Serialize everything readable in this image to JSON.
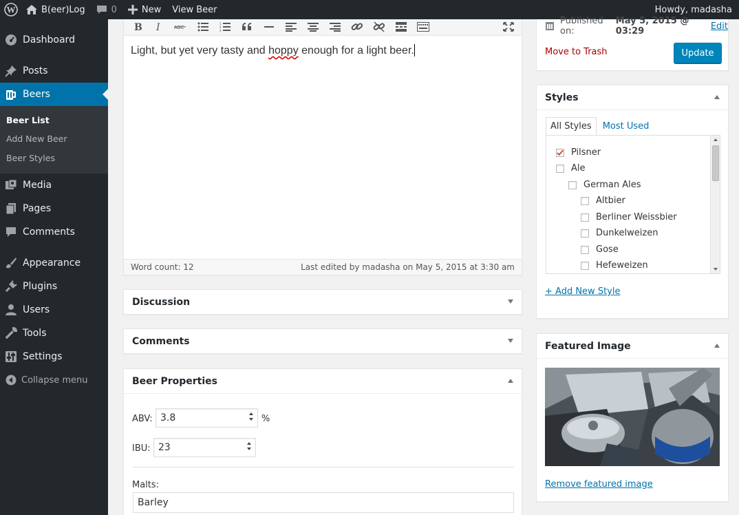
{
  "adminbar": {
    "site_name": "B(eer)Log",
    "comments_count": "0",
    "new_label": "New",
    "view_label": "View Beer",
    "greeting": "Howdy, madasha"
  },
  "sidebar": {
    "items": [
      {
        "label": "Dashboard",
        "icon": "dashboard-icon"
      },
      {
        "label": "Posts",
        "icon": "pushpin-icon"
      },
      {
        "label": "Beers",
        "icon": "beer-mug-icon"
      },
      {
        "label": "Media",
        "icon": "media-icon"
      },
      {
        "label": "Pages",
        "icon": "pages-icon"
      },
      {
        "label": "Comments",
        "icon": "comment-icon"
      },
      {
        "label": "Appearance",
        "icon": "paintbrush-icon"
      },
      {
        "label": "Plugins",
        "icon": "plug-icon"
      },
      {
        "label": "Users",
        "icon": "users-icon"
      },
      {
        "label": "Tools",
        "icon": "wrench-icon"
      },
      {
        "label": "Settings",
        "icon": "settings-icon"
      }
    ],
    "submenu": [
      "Beer List",
      "Add New Beer",
      "Beer Styles"
    ],
    "collapse_label": "Collapse menu",
    "active_color": "#0073aa"
  },
  "editor": {
    "content_before": "Light, but yet very tasty and ",
    "content_misspelled": "hoppy",
    "content_after": " enough for a light beer.",
    "word_count": "Word count: 12",
    "last_edited": "Last edited by madasha on May 5, 2015 at 3:30 am"
  },
  "boxes": {
    "discussion_title": "Discussion",
    "comments_title": "Comments",
    "beer_properties_title": "Beer Properties"
  },
  "beer_properties": {
    "abv_label": "ABV:",
    "abv_value": "3.8",
    "abv_unit": "%",
    "ibu_label": "IBU:",
    "ibu_value": "23",
    "malts_label": "Malts:",
    "malts_value": "Barley"
  },
  "publish": {
    "published_prefix": "Published on: ",
    "published_date": "May 5, 2015 @ 03:29",
    "edit_link": "Edit",
    "trash_label": "Move to Trash",
    "update_label": "Update"
  },
  "styles": {
    "title": "Styles",
    "tab_all": "All Styles",
    "tab_most_used": "Most Used",
    "terms": [
      {
        "label": "Pilsner",
        "checked": true
      },
      {
        "label": "Ale",
        "checked": false
      },
      {
        "label": "German Ales",
        "checked": false
      },
      {
        "label": "Altbier",
        "checked": false
      },
      {
        "label": "Berliner Weissbier",
        "checked": false
      },
      {
        "label": "Dunkelweizen",
        "checked": false
      },
      {
        "label": "Gose",
        "checked": false
      },
      {
        "label": "Hefeweizen",
        "checked": false
      }
    ],
    "add_new_label": "+ Add New Style"
  },
  "featured": {
    "title": "Featured Image",
    "remove_label": "Remove featured image"
  }
}
